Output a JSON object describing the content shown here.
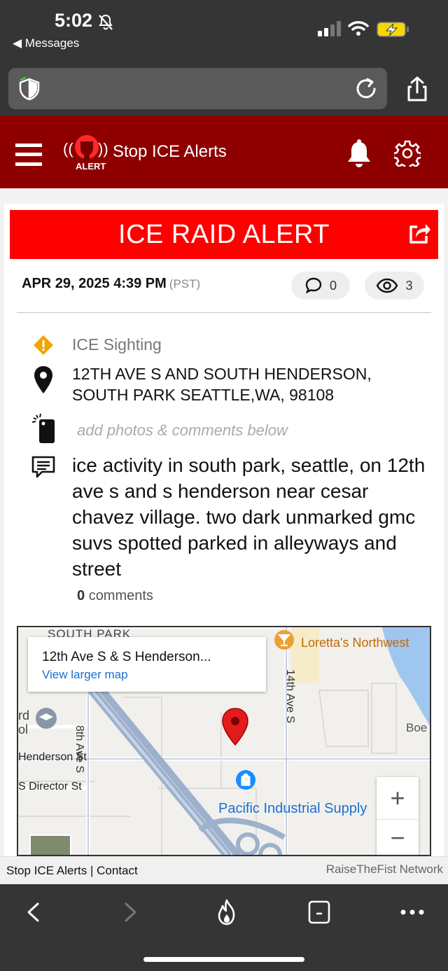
{
  "status_bar": {
    "time": "5:02",
    "back_label": "Messages"
  },
  "icons": {
    "silent": "bell-slash-icon",
    "signal": "cellular-signal-icon",
    "wifi": "wifi-icon",
    "battery": "battery-charging-icon",
    "shield": "shield-icon",
    "reload": "reload-icon",
    "share": "share-icon",
    "menu": "hamburger-icon",
    "notifications": "bell-icon",
    "settings": "gear-icon"
  },
  "app": {
    "title": "Stop ICE Alerts",
    "logo_text": "ALERT",
    "brand_color": "#8e0000"
  },
  "alert": {
    "banner_title": "ICE RAID ALERT",
    "banner_color": "#ff0000",
    "date": "APR 29, 2025 4:39 PM",
    "timezone": "(PST)",
    "comment_count": "0",
    "view_count": "3",
    "type": "ICE Sighting",
    "address_line1": "12TH AVE S AND SOUTH HENDERSON,",
    "address_line2": "SOUTH PARK SEATTLE,WA, 98108",
    "add_photos_hint": "add photos & comments below",
    "description": "ice activity in south park, seattle, on 12th ave s and s henderson near cesar chavez village. two dark unmarked gmc suvs spotted parked in alleyways and street",
    "comments_number": "0",
    "comments_label": "comments"
  },
  "map": {
    "card_title": "12th Ave S & S Henderson...",
    "card_link": "View larger map",
    "labels": {
      "area": "SOUTH PARK",
      "poi_restaurant": "Loretta's Northwest",
      "poi_store": "Pacific Industrial Supply",
      "street_henderson": "Henderson St",
      "street_director": "S Director St",
      "street_8th": "8th Ave S",
      "street_14th": "14th Ave S",
      "edge_right": "Boe",
      "edge_left_1": "rd",
      "edge_left_2": "ol"
    },
    "zoom_in": "+",
    "zoom_out": "−"
  },
  "footer": {
    "left": "Stop ICE Alerts | Contact",
    "right": "RaiseTheFist Network"
  }
}
